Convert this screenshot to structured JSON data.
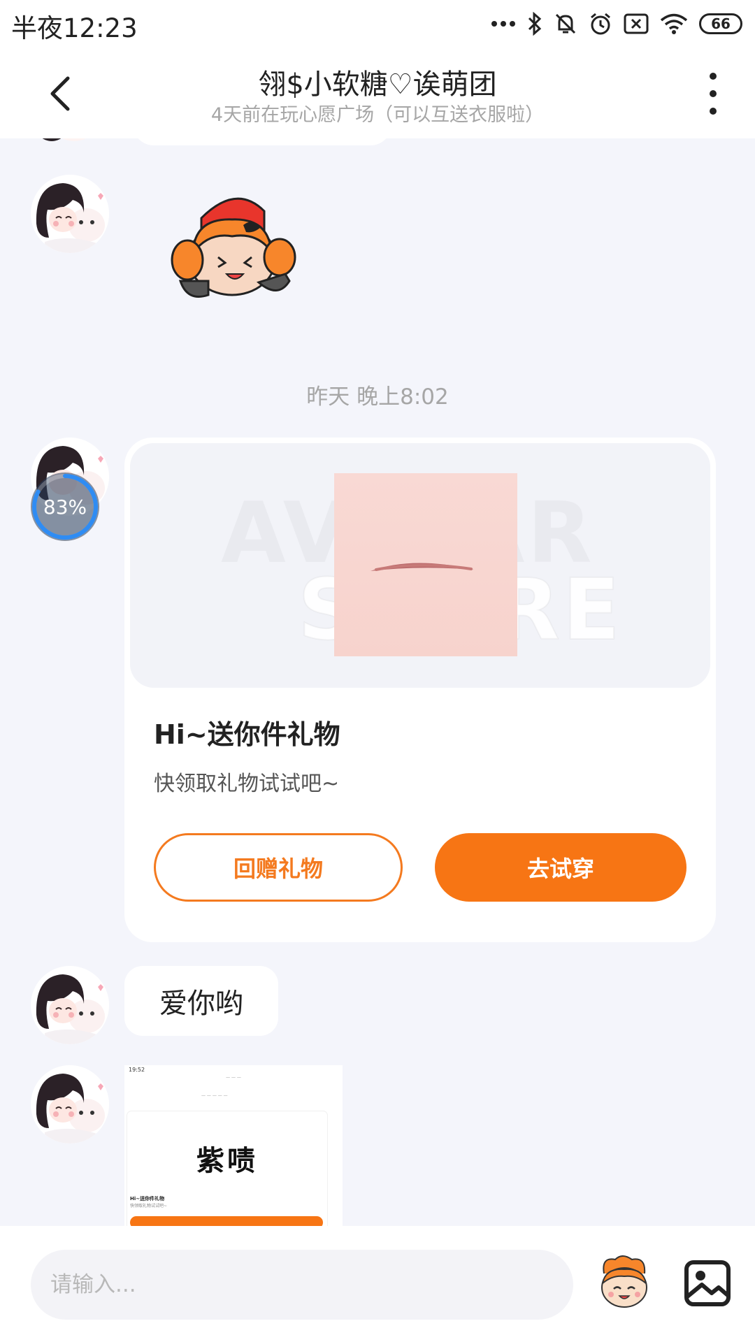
{
  "status_bar": {
    "time": "半夜12:23",
    "battery": "66",
    "icons": [
      "more-dots-icon",
      "bluetooth-icon",
      "mute-bell-icon",
      "alarm-icon",
      "sim-off-icon",
      "wifi-icon",
      "battery-icon"
    ]
  },
  "header": {
    "title": "翎$小软糖♡诶萌团",
    "subtitle": "4天前在玩心愿广场（可以互送衣服啦）",
    "back_icon": "chevron-left-icon",
    "more_icon": "more-vertical-icon"
  },
  "chat": {
    "timestamp": "昨天 晚上8:02",
    "upload_progress": {
      "percent": 83,
      "label": "83%"
    },
    "gift_card": {
      "title": "Hi~送你件礼物",
      "description": "快领取礼物试试吧~",
      "return_gift_label": "回赠礼物",
      "try_on_label": "去试穿"
    },
    "text_message": "爱你哟",
    "screenshot_preview": {
      "status_time": "19:52",
      "big_text": "紫啧",
      "card_title": "Hi~送你件礼物",
      "card_desc": "快领取礼物试试吧~"
    }
  },
  "input_bar": {
    "placeholder": "请输入...",
    "emoji_icon": "mascot-sticker-icon",
    "image_icon": "image-icon"
  },
  "colors": {
    "accent": "#f77514",
    "background": "#f4f5fb",
    "progress_ring": "#2f8cf3"
  }
}
